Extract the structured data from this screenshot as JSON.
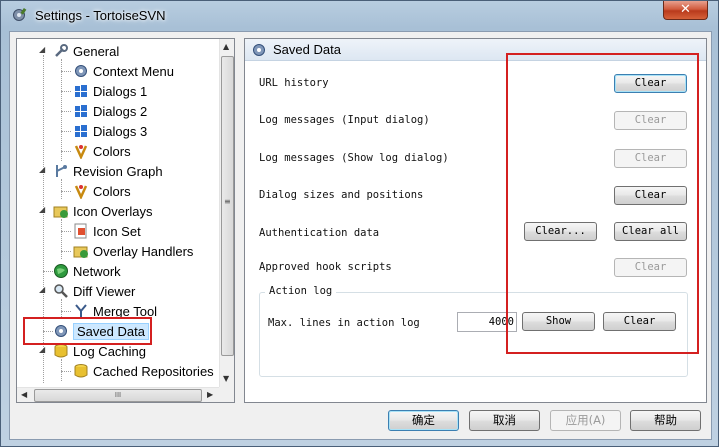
{
  "window": {
    "title": "Settings - TortoiseSVN",
    "close_glyph": "✕"
  },
  "tree": {
    "items": [
      {
        "label": "General",
        "icon": "wrench-icon"
      },
      {
        "label": "Context Menu",
        "icon": "gear-icon"
      },
      {
        "label": "Dialogs 1",
        "icon": "windows-icon"
      },
      {
        "label": "Dialogs 2",
        "icon": "windows-icon"
      },
      {
        "label": "Dialogs 3",
        "icon": "windows-icon"
      },
      {
        "label": "Colors",
        "icon": "palette-icon"
      },
      {
        "label": "Revision Graph",
        "icon": "graph-icon"
      },
      {
        "label": "Colors",
        "icon": "palette-icon"
      },
      {
        "label": "Icon Overlays",
        "icon": "overlay-icon"
      },
      {
        "label": "Icon Set",
        "icon": "iconset-icon"
      },
      {
        "label": "Overlay Handlers",
        "icon": "overlay-icon"
      },
      {
        "label": "Network",
        "icon": "globe-icon"
      },
      {
        "label": "Diff Viewer",
        "icon": "magnifier-icon"
      },
      {
        "label": "Merge Tool",
        "icon": "merge-icon"
      },
      {
        "label": "Saved Data",
        "icon": "gear-icon"
      },
      {
        "label": "Log Caching",
        "icon": "database-icon"
      },
      {
        "label": "Cached Repositories",
        "icon": "database-icon"
      }
    ],
    "selected": "Saved Data",
    "hscroll_grip": "III",
    "vscroll_grip": "≡"
  },
  "panel": {
    "header": "Saved Data",
    "rows": [
      {
        "label": "URL history",
        "button": "Clear",
        "enabled": true
      },
      {
        "label": "Log messages (Input dialog)",
        "button": "Clear",
        "enabled": false
      },
      {
        "label": "Log messages (Show log dialog)",
        "button": "Clear",
        "enabled": false
      },
      {
        "label": "Dialog sizes and positions",
        "button": "Clear",
        "enabled": true
      },
      {
        "label": "Authentication data",
        "button": "Clear...",
        "button2": "Clear all",
        "enabled": true
      },
      {
        "label": "Approved hook scripts",
        "button": "Clear",
        "enabled": false
      }
    ],
    "action_log": {
      "title": "Action log",
      "label": "Max. lines in action log",
      "value": "4000",
      "show_button": "Show",
      "clear_button": "Clear"
    }
  },
  "dialog_buttons": {
    "ok": "确定",
    "cancel": "取消",
    "apply": "应用(A)",
    "help": "帮助"
  },
  "colors": {
    "highlight_box": "#d42020",
    "selection": "#cde8ff"
  }
}
